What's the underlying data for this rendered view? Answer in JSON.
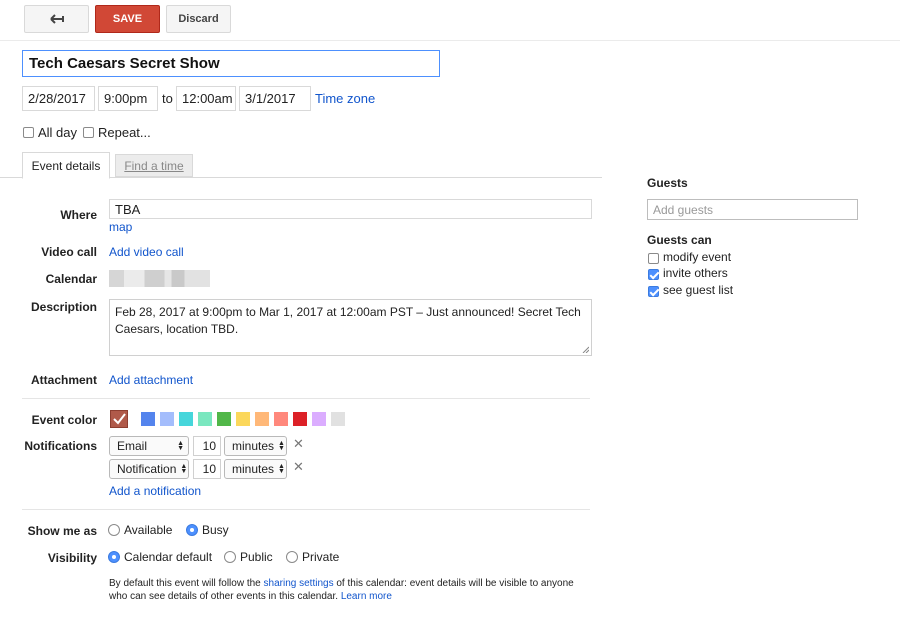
{
  "toolbar": {
    "back_icon": "back-arrow-icon",
    "save_label": "SAVE",
    "discard_label": "Discard"
  },
  "event": {
    "title": "Tech Caesars Secret Show",
    "start_date": "2/28/2017",
    "start_time": "9:00pm",
    "to_label": "to",
    "end_time": "12:00am",
    "end_date": "3/1/2017",
    "timezone_link": "Time zone",
    "all_day_label": "All day",
    "all_day_checked": false,
    "repeat_label": "Repeat...",
    "repeat_checked": false
  },
  "tabs": {
    "event_details": "Event details",
    "find_a_time": "Find a time"
  },
  "details": {
    "where_label": "Where",
    "where_value": "TBA",
    "map_link": "map",
    "video_call_label": "Video call",
    "add_video_call": "Add video call",
    "calendar_label": "Calendar",
    "description_label": "Description",
    "description_value": "Feb 28, 2017 at 9:00pm to Mar 1, 2017 at 12:00am PST – Just announced! Secret Tech Caesars, location TBD.",
    "attachment_label": "Attachment",
    "add_attachment": "Add attachment",
    "event_color_label": "Event color",
    "colors": [
      "#5484ed",
      "#a4bdfc",
      "#46d6db",
      "#7ae7bf",
      "#51b749",
      "#fbd75b",
      "#ffb878",
      "#ff887c",
      "#dc2127",
      "#dbadff",
      "#e1e1e1"
    ],
    "selected_color": "#b05a4a",
    "notifications_label": "Notifications",
    "notifications": [
      {
        "method": "Email",
        "amount": "10",
        "unit": "minutes"
      },
      {
        "method": "Notification",
        "amount": "10",
        "unit": "minutes"
      }
    ],
    "add_notification": "Add a notification",
    "show_me_as_label": "Show me as",
    "show_me_as_options": [
      "Available",
      "Busy"
    ],
    "show_me_as_selected": "Busy",
    "visibility_label": "Visibility",
    "visibility_options": [
      "Calendar default",
      "Public",
      "Private"
    ],
    "visibility_selected": "Calendar default",
    "footnote_pre": "By default this event will follow the ",
    "footnote_link": "sharing settings",
    "footnote_post": " of this calendar: event details will be visible to anyone who can see details of other events in this calendar.",
    "learn_more": "Learn more"
  },
  "guests": {
    "heading": "Guests",
    "input_placeholder": "Add guests",
    "guests_can_heading": "Guests can",
    "permissions": [
      {
        "label": "modify event",
        "checked": false
      },
      {
        "label": "invite others",
        "checked": true
      },
      {
        "label": "see guest list",
        "checked": true
      }
    ]
  }
}
